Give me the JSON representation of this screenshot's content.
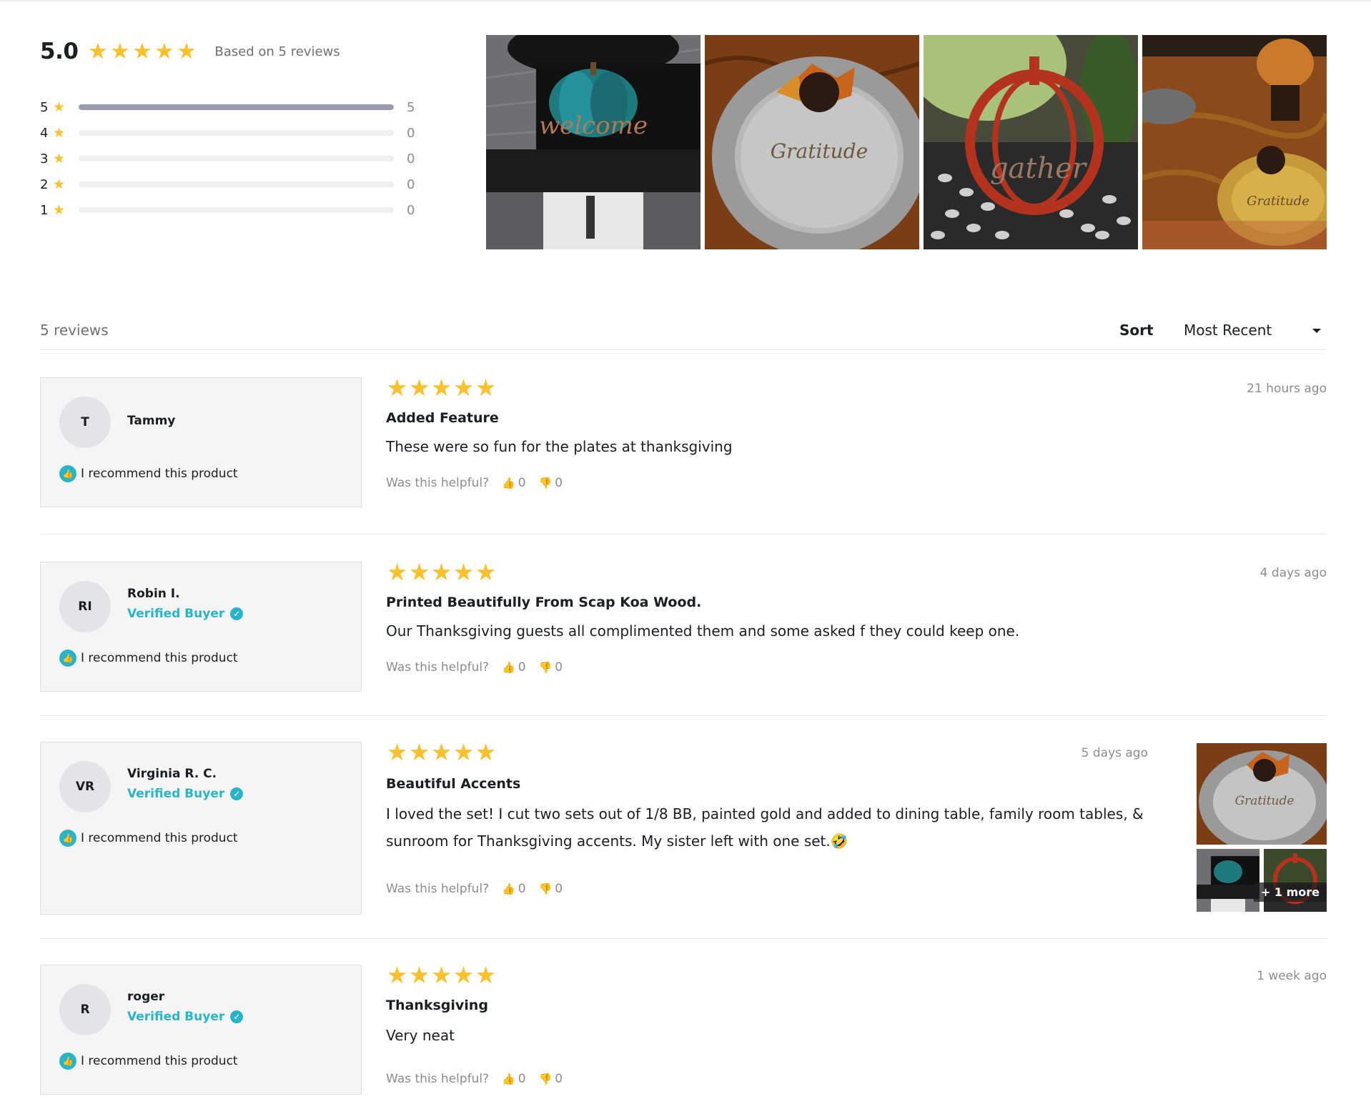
{
  "summary": {
    "average": "5.0",
    "based_on": "Based on 5 reviews",
    "distribution": [
      {
        "stars": "5",
        "count": "5",
        "fraction": 1.0
      },
      {
        "stars": "4",
        "count": "0",
        "fraction": 0
      },
      {
        "stars": "3",
        "count": "0",
        "fraction": 0
      },
      {
        "stars": "2",
        "count": "0",
        "fraction": 0
      },
      {
        "stars": "1",
        "count": "0",
        "fraction": 0
      }
    ]
  },
  "photos": [
    {
      "icon": "photo-welcome-pumpkin",
      "caption": "welcome"
    },
    {
      "icon": "photo-gratitude-plate",
      "caption": "gratitude"
    },
    {
      "icon": "photo-gather-pumpkin",
      "caption": "gather"
    },
    {
      "icon": "photo-table-setting",
      "caption": ""
    }
  ],
  "toolbar": {
    "count_label": "5 reviews",
    "sort_label": "Sort",
    "sort_value": "Most Recent"
  },
  "colors": {
    "star": "#fbc02d",
    "verified": "#2ab4c8",
    "bar_fill": "#9a9bb0"
  },
  "reviews": [
    {
      "initials": "T",
      "name": "Tammy",
      "verified": "",
      "recommend": "I recommend this product",
      "rating": 5,
      "title": "Added Feature",
      "text": "These were so fun for the plates at thanksgiving",
      "date": "21 hours ago",
      "helpful_label": "Was this helpful?",
      "up": "0",
      "down": "0"
    },
    {
      "initials": "RI",
      "name": "Robin I.",
      "verified": "Verified Buyer",
      "recommend": "I recommend this product",
      "rating": 5,
      "title": "Printed Beautifully From Scap Koa Wood.",
      "text": "Our Thanksgiving guests all complimented them and some asked f they could keep one.",
      "date": "4 days ago",
      "helpful_label": "Was this helpful?",
      "up": "0",
      "down": "0"
    },
    {
      "initials": "VR",
      "name": "Virginia R. C.",
      "verified": "Verified Buyer",
      "recommend": "I recommend this product",
      "rating": 5,
      "title": "Beautiful Accents",
      "text": "I loved the set! I cut two sets out of 1/8 BB, painted gold and added to dining table, family room tables, & sunroom for Thanksgiving accents. My sister left with one set.🤣",
      "date": "5 days ago",
      "helpful_label": "Was this helpful?",
      "up": "0",
      "down": "0",
      "more_label": "+ 1 more"
    },
    {
      "initials": "R",
      "name": "roger",
      "verified": "Verified Buyer",
      "recommend": "I recommend this product",
      "rating": 5,
      "title": "Thanksgiving",
      "text": "Very neat",
      "date": "1 week ago",
      "helpful_label": "Was this helpful?",
      "up": "0",
      "down": "0"
    }
  ]
}
